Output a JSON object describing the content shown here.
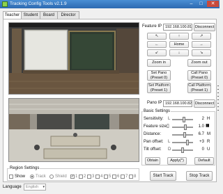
{
  "window": {
    "title": "Tracking Config Tools v2.1.9"
  },
  "tabs": [
    "Teacher",
    "Student",
    "Board",
    "Director"
  ],
  "feature": {
    "ip_label": "Feature IP",
    "ip_value": "192.168.100.81",
    "disconnect": "Disconnect",
    "ptz": {
      "up_left": "↖",
      "up": "↑",
      "up_right": "↗",
      "left": "←",
      "home": "Home",
      "right": "→",
      "down_left": "↙",
      "down": "↓",
      "down_right": "↘"
    },
    "zoom_in": "Zoom in",
    "zoom_out": "Zoom out",
    "set_pano": "Set Pano\n(Preset 0)",
    "call_pano": "Call Pano\n(Preset 0)",
    "set_platform": "Set Platform\n(Preset 1)",
    "call_platform": "Call Platform\n(Preset 1)"
  },
  "pano": {
    "ip_label": "Pano IP",
    "ip_value": "192.168.100.82",
    "disconnect": "Disconnect"
  },
  "basic_settings": {
    "title": "Basic Settings",
    "rows": [
      {
        "label": "Sensitivity:",
        "min": "L",
        "value": "2",
        "max": "H",
        "level": 0.55
      },
      {
        "label": "Feature size:",
        "min": "",
        "value": "1.0",
        "max": "",
        "level": 0.62
      },
      {
        "label": "Distance:",
        "min": "",
        "value": "6.7",
        "max": "M",
        "level": 0.6
      },
      {
        "label": "Pan offset:",
        "min": "L",
        "value": "+3",
        "max": "R",
        "level": 0.72
      },
      {
        "label": "Tilt offset:",
        "min": "D",
        "value": "0",
        "max": "U",
        "level": 0.5
      }
    ],
    "obtain": "Obtain",
    "apply": "Apply(*)",
    "default": "Default"
  },
  "region": {
    "title": "Region Settings",
    "show": "Show",
    "track": "Track",
    "shield": "Shield",
    "numbers": [
      "1",
      "2",
      "3",
      "4",
      "5",
      "6",
      "7",
      "8"
    ]
  },
  "start_track": "Start Track",
  "stop_track": "Stop Track",
  "language": {
    "label": "Language",
    "value": "English"
  }
}
